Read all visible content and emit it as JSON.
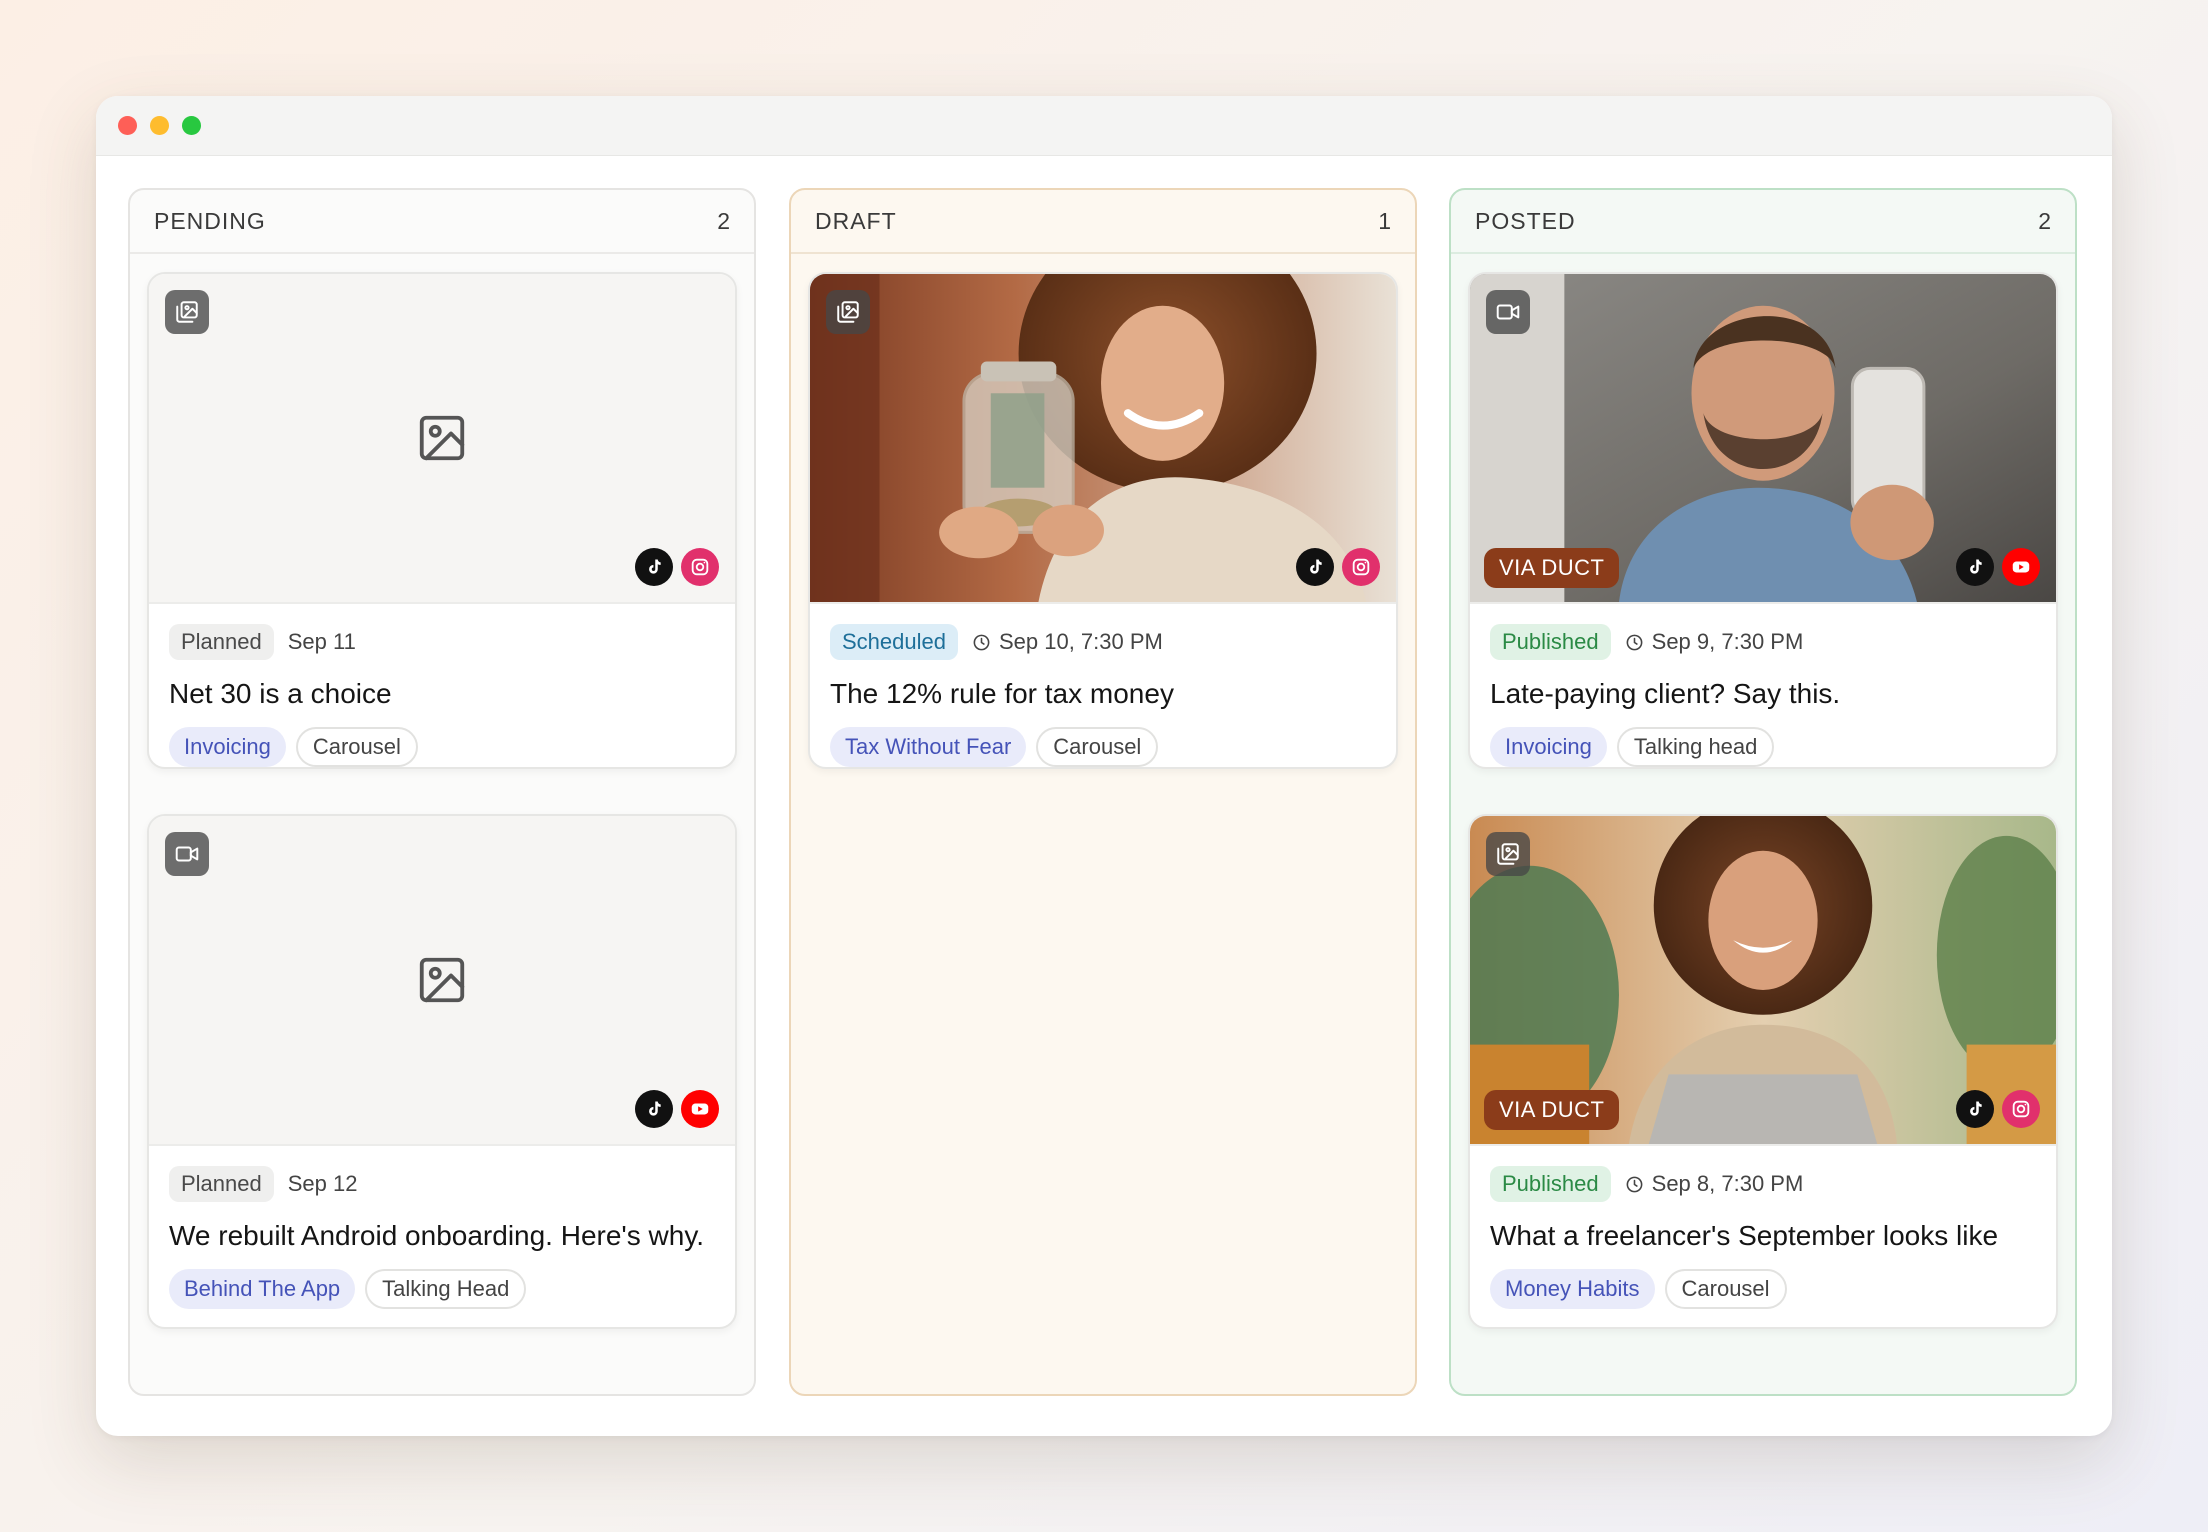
{
  "colors": {
    "pending_border": "#e5e4e2",
    "draft_border": "#ecd6b8",
    "posted_border": "#bde0c6",
    "via_badge": "#8b3c1a",
    "topic_tag": "#4553b8"
  },
  "columns": {
    "pending": {
      "title": "PENDING",
      "count": "2",
      "cards": [
        {
          "type_icon": "carousel-icon",
          "platforms": [
            "tiktok",
            "instagram"
          ],
          "status": "Planned",
          "date": "Sep 11",
          "title": "Net 30 is a choice",
          "topic_tag": "Invoicing",
          "format_tag": "Carousel"
        },
        {
          "type_icon": "video-icon",
          "platforms": [
            "tiktok",
            "youtube"
          ],
          "status": "Planned",
          "date": "Sep 12",
          "title": "We rebuilt Android onboarding. Here's why.",
          "topic_tag": "Behind The App",
          "format_tag": "Talking Head"
        }
      ]
    },
    "draft": {
      "title": "DRAFT",
      "count": "1",
      "cards": [
        {
          "type_icon": "carousel-icon",
          "platforms": [
            "tiktok",
            "instagram"
          ],
          "status": "Scheduled",
          "date": "Sep 10, 7:30 PM",
          "title": "The 12% rule for tax money",
          "topic_tag": "Tax Without Fear",
          "format_tag": "Carousel"
        }
      ]
    },
    "posted": {
      "title": "POSTED",
      "count": "2",
      "cards": [
        {
          "type_icon": "video-icon",
          "via": "VIA DUCT",
          "platforms": [
            "tiktok",
            "youtube"
          ],
          "status": "Published",
          "date": "Sep 9, 7:30 PM",
          "title": "Late-paying client? Say this.",
          "topic_tag": "Invoicing",
          "format_tag": "Talking head"
        },
        {
          "type_icon": "carousel-icon",
          "via": "VIA DUCT",
          "platforms": [
            "tiktok",
            "instagram"
          ],
          "status": "Published",
          "date": "Sep 8, 7:30 PM",
          "title": "What a freelancer's September looks like",
          "topic_tag": "Money Habits",
          "format_tag": "Carousel"
        }
      ]
    }
  }
}
